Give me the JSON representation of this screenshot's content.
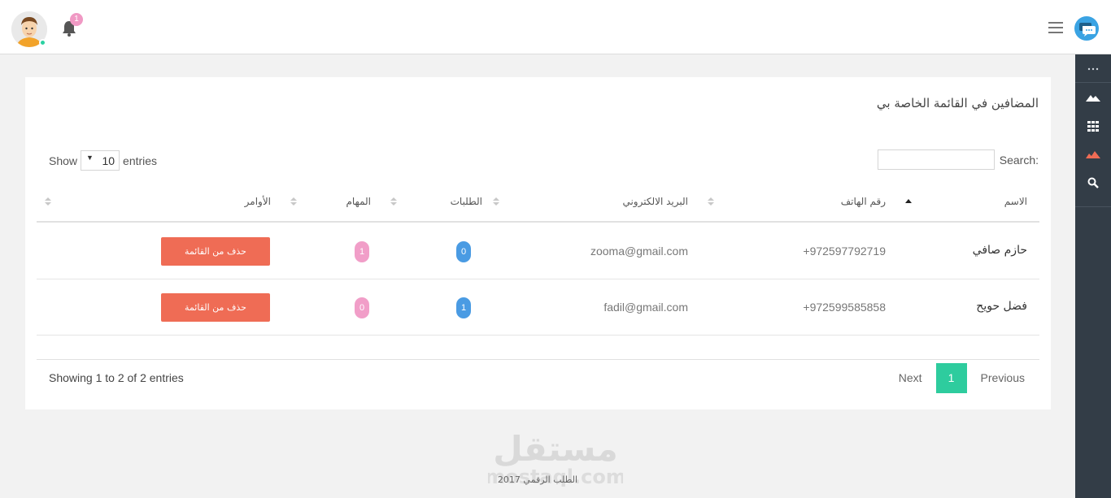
{
  "header": {
    "notifications_count": "1",
    "colors": {
      "badge": "#f099c4",
      "online": "#2bd1a2",
      "logo": "#3aa3e3"
    }
  },
  "rail": {
    "icons": [
      "dots-icon",
      "mountains-icon",
      "grid-icon",
      "chart-icon",
      "search-icon"
    ],
    "colors": {
      "bg": "#333d47",
      "active": "#ef6c55"
    }
  },
  "page": {
    "title": "المضافين في القائمة الخاصة بي"
  },
  "table_controls": {
    "show_label": "Show",
    "entries_label": "entries",
    "page_length": "10",
    "search_label": "Search:",
    "search_value": ""
  },
  "table": {
    "columns": [
      "الاسم",
      "رقم الهاتف",
      "البريد الالكتروني",
      "الطلبات",
      "المهام",
      "الأوامر"
    ],
    "rows": [
      {
        "name": "حازم صافي",
        "phone": "+972597792719",
        "email": "zooma@gmail.com",
        "orders": "0",
        "tasks": "1",
        "action": "حذف من القائمة"
      },
      {
        "name": "فضل حويح",
        "phone": "+972599585858",
        "email": "fadil@gmail.com",
        "orders": "1",
        "tasks": "0",
        "action": "حذف من القائمة"
      }
    ],
    "colors": {
      "orders_pill": "#4a9be3",
      "tasks_pill": "#f19ec8",
      "action_button": "#ef6c55"
    }
  },
  "pagination": {
    "info": "Showing 1 to 2 of 2 entries",
    "next": "Next",
    "current": "1",
    "previous": "Previous",
    "active_color": "#2ecc9e"
  },
  "footer": {
    "watermark_lines": [
      "مستقل",
      "mostaql.com"
    ],
    "copyright": "الطلب الرقمي 2017"
  }
}
